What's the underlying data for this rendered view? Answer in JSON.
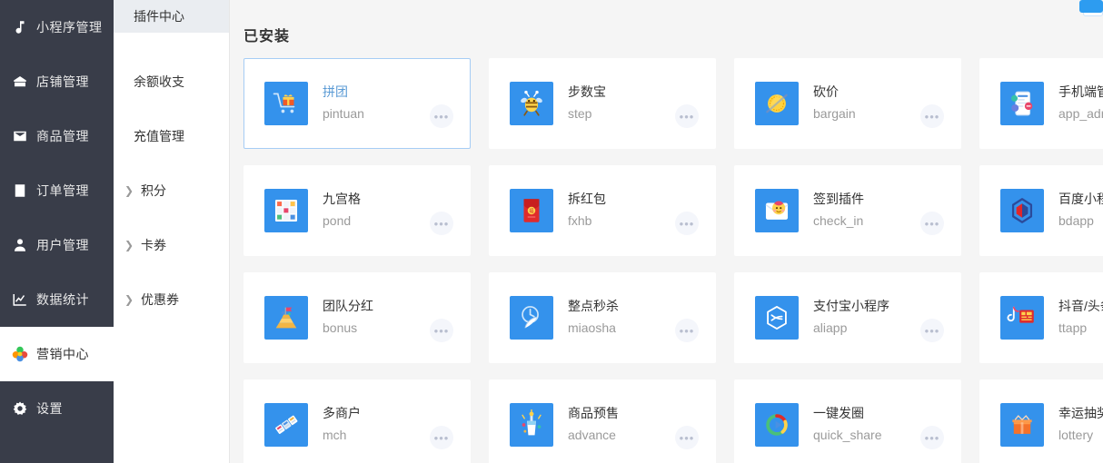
{
  "sidebar": {
    "items": [
      {
        "label": "小程序管理",
        "icon": "music-note-icon",
        "active": false
      },
      {
        "label": "店铺管理",
        "icon": "shop-icon",
        "active": false
      },
      {
        "label": "商品管理",
        "icon": "mail-box-icon",
        "active": false
      },
      {
        "label": "订单管理",
        "icon": "order-list-icon",
        "active": false
      },
      {
        "label": "用户管理",
        "icon": "user-icon",
        "active": false
      },
      {
        "label": "数据统计",
        "icon": "chart-icon",
        "active": false
      },
      {
        "label": "营销中心",
        "icon": "marketing-flower-icon",
        "active": true
      },
      {
        "label": "设置",
        "icon": "gear-icon",
        "active": false
      }
    ]
  },
  "submenu": {
    "items": [
      {
        "label": "插件中心",
        "active": true,
        "expandable": false
      },
      {
        "label": "余额收支",
        "active": false,
        "expandable": false
      },
      {
        "label": "充值管理",
        "active": false,
        "expandable": false
      },
      {
        "label": "积分",
        "active": false,
        "expandable": true
      },
      {
        "label": "卡券",
        "active": false,
        "expandable": true
      },
      {
        "label": "优惠券",
        "active": false,
        "expandable": true
      }
    ],
    "caret": "❯"
  },
  "main": {
    "section_title": "已安装",
    "more_label": "•••",
    "plugins": [
      {
        "title": "拼团",
        "code": "pintuan",
        "icon": "cart-gift-icon",
        "selected": true
      },
      {
        "title": "步数宝",
        "code": "step",
        "icon": "step-bee-icon",
        "selected": false
      },
      {
        "title": "砍价",
        "code": "bargain",
        "icon": "bargain-axe-icon",
        "selected": false
      },
      {
        "title": "手机端管理",
        "code": "app_admin",
        "icon": "phone-admin-icon",
        "selected": false
      },
      {
        "title": "九宫格",
        "code": "pond",
        "icon": "grid-nine-icon",
        "selected": false
      },
      {
        "title": "拆红包",
        "code": "fxhb",
        "icon": "red-packet-icon",
        "selected": false
      },
      {
        "title": "签到插件",
        "code": "check_in",
        "icon": "check-in-icon",
        "selected": false
      },
      {
        "title": "百度小程序",
        "code": "bdapp",
        "icon": "baidu-app-icon",
        "selected": false
      },
      {
        "title": "团队分红",
        "code": "bonus",
        "icon": "bonus-podium-icon",
        "selected": false
      },
      {
        "title": "整点秒杀",
        "code": "miaosha",
        "icon": "seckill-clock-icon",
        "selected": false
      },
      {
        "title": "支付宝小程序",
        "code": "aliapp",
        "icon": "alipay-app-icon",
        "selected": false
      },
      {
        "title": "抖音/头条",
        "code": "ttapp",
        "icon": "douyin-icon",
        "selected": false
      },
      {
        "title": "多商户",
        "code": "mch",
        "icon": "multi-shop-icon",
        "selected": false
      },
      {
        "title": "商品预售",
        "code": "advance",
        "icon": "presale-icon",
        "selected": false
      },
      {
        "title": "一键发圈",
        "code": "quick_share",
        "icon": "quick-share-icon",
        "selected": false
      },
      {
        "title": "幸运抽奖",
        "code": "lottery",
        "icon": "lottery-box-icon",
        "selected": false
      }
    ]
  },
  "colors": {
    "sidebar_bg": "#393d49",
    "accent": "#3492ec",
    "selected_border": "#a6cdf5",
    "selected_title": "#5b9bd5",
    "page_bg": "#f5f5f5",
    "submenu_active_bg": "#eaedf1"
  }
}
